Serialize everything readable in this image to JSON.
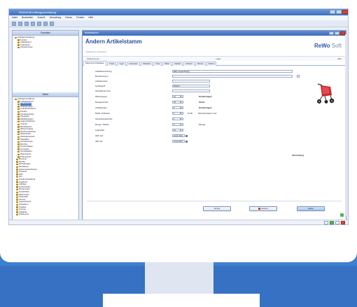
{
  "app": {
    "title": "ReWoSoft Auftragsverwaltung",
    "menu": [
      "Datei",
      "Bearbeiten",
      "Ansicht",
      "Verwaltung",
      "Extras",
      "Fenster",
      "Hilfe"
    ]
  },
  "left_panel": {
    "top_title": "Favoriten",
    "top_items": [
      "Auftragsverwaltung",
      "Kunden",
      "Artikelstamm",
      "Lieferanten",
      "Auswertungen"
    ],
    "bottom_title": "Menü",
    "tree": [
      "Auftragsverwaltung",
      "Auftragsstamm",
      "Artikelstamm",
      "Artikelgruppen",
      "Lieferantenstamm",
      "Kunden",
      "Kundengruppen",
      "Preislisten",
      "Rabattgruppen",
      "Lagerverwaltung",
      "Inventur",
      "Bestellwesen",
      "Wareneingang",
      "Rechnungswesen",
      "Mahnwesen",
      "Zahlungsverkehr",
      "Statistiken",
      "Auswertungen",
      "Berichte",
      "Druckvorlagen",
      "Formulare",
      "Schnittstellen",
      "Datenimport",
      "Datenexport",
      "Benutzer",
      "Rechte",
      "Einstellungen",
      "Mandanten",
      "Systemeinstellungen",
      "Protokoll",
      "Hilfe",
      "Info",
      "Kundenverwaltung",
      "Angebote",
      "Aufträge",
      "Lieferscheine",
      "Rechnungen",
      "Gutschriften",
      "Mahnungen",
      "Zahlungen",
      "Service",
      "Lagerbestand",
      "Produktion",
      "Projekte",
      "Termine",
      "Aufgaben",
      "Dokumente"
    ],
    "selected_index": 2
  },
  "main": {
    "window_title": "Artikelstamm",
    "heading": "Ändern Artikelstamm",
    "sub_line": "Artikelstamm bearbeiten",
    "logo_left": "ReWo",
    "logo_right": "Soft",
    "subbar_left": "Artikelnummer",
    "subbar_mid": "Lager",
    "subbar_right": "Aktiv",
    "tabs": [
      "Allgemeine Artikeldaten",
      "Preise",
      "Lager",
      "Lieferanten",
      "Stückliste",
      "Texte",
      "Bilder",
      "Statistik",
      "Zubehör",
      "Historie",
      "Notizen"
    ],
    "active_tab": 0,
    "fields": [
      {
        "label": "Artikelbezeichnung",
        "value": "Baby-Jogger Buggy"
      },
      {
        "label": "Bezeichnung 2",
        "value": ""
      },
      {
        "label": "Artikelkurztext",
        "value": ""
      },
      {
        "label": "Suchbegriff",
        "value": "BUGGY"
      },
      {
        "label": "Herstellernummer",
        "value": ""
      },
      {
        "label": "Warengruppe",
        "value": "12",
        "side": "Kinderwagen",
        "side_bold": true
      },
      {
        "label": "Mengeneinheit",
        "value": "ST",
        "side": "Stück",
        "side_bold": true
      },
      {
        "label": "Artikelgruppe",
        "value": "5",
        "side": "Kinderwagen",
        "side_bold": true
      },
      {
        "label": "MwSt.-Schlüssel",
        "value": "1",
        "side": "Mehrwertsteuer voll",
        "side_bold": false,
        "extra": "19,00"
      },
      {
        "label": "Verpackungseinheit",
        "value": "1"
      },
      {
        "label": "Menge / Palette",
        "value": "0",
        "side": "Menge",
        "side_bold": false
      },
      {
        "label": "Lagerplatz",
        "value": "A1"
      },
      {
        "label": "Aktiv seit",
        "value": "01.01.2012"
      },
      {
        "label": "Aktiv bis",
        "value": "31.12.2015"
      }
    ],
    "note": "Bemerkung",
    "buttons": {
      "back": "Zurück",
      "delete": "Löschen",
      "next": "Weiter"
    }
  }
}
